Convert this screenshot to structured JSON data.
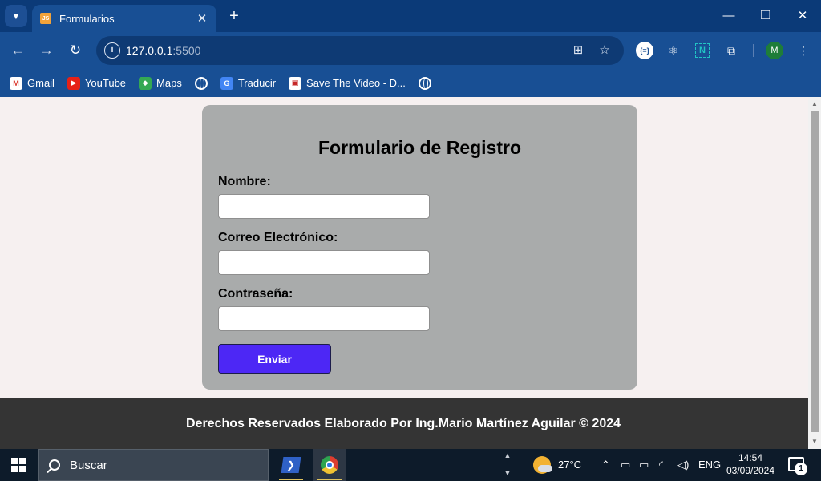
{
  "browser": {
    "tab": {
      "title": "Formularios",
      "favicon": "JS"
    },
    "url": {
      "host": "127.0.0.1",
      "port": ":5500"
    },
    "bookmarks": [
      {
        "label": "Gmail",
        "icon": "gmail-icon"
      },
      {
        "label": "YouTube",
        "icon": "youtube-icon"
      },
      {
        "label": "Maps",
        "icon": "maps-icon"
      },
      {
        "label": "",
        "icon": "globe-icon"
      },
      {
        "label": "Traducir",
        "icon": "translate-icon"
      },
      {
        "label": "Save The Video - D...",
        "icon": "save-video-icon"
      },
      {
        "label": "",
        "icon": "globe-icon"
      }
    ],
    "profile_initial": "M",
    "extension_json_label": "{≡}",
    "extension_n_label": "N"
  },
  "form": {
    "title": "Formulario de Registro",
    "fields": [
      {
        "label": "Nombre:",
        "value": "",
        "placeholder": ""
      },
      {
        "label": "Correo Electrónico:",
        "value": "",
        "placeholder": ""
      },
      {
        "label": "Contraseña:",
        "value": "",
        "placeholder": ""
      }
    ],
    "submit_label": "Enviar"
  },
  "footer": {
    "text": "Derechos Reservados Elaborado Por Ing.Mario Martínez Aguilar © 2024"
  },
  "taskbar": {
    "search_label": "Buscar",
    "temperature": "27°C",
    "language": "ENG",
    "time": "14:54",
    "date": "03/09/2024",
    "notification_count": "1"
  },
  "colors": {
    "browser_frame": "#184f94",
    "card_background": "#a9abab",
    "submit_button": "#4d27f5",
    "footer_background": "#343434"
  }
}
